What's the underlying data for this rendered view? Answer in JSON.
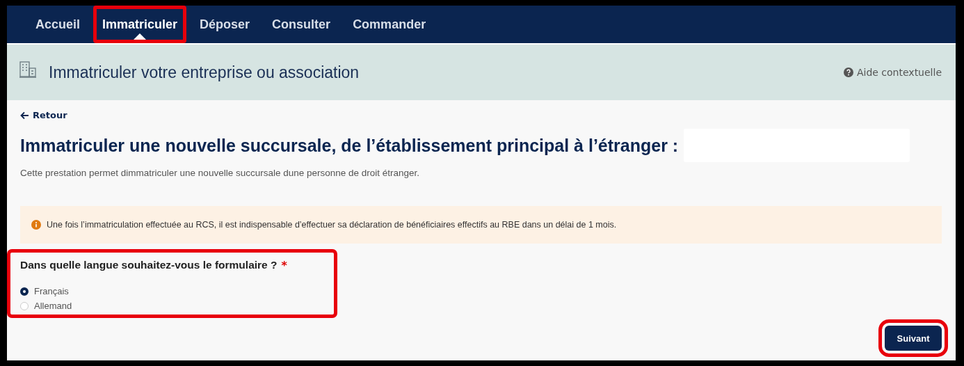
{
  "nav": {
    "tabs": [
      {
        "label": "Accueil",
        "selected": false,
        "highlighted": false
      },
      {
        "label": "Immatriculer",
        "selected": true,
        "highlighted": true
      },
      {
        "label": "Déposer",
        "selected": false,
        "highlighted": false
      },
      {
        "label": "Consulter",
        "selected": false,
        "highlighted": false
      },
      {
        "label": "Commander",
        "selected": false,
        "highlighted": false
      }
    ]
  },
  "header": {
    "title": "Immatriculer votre entreprise ou association",
    "help": "Aide contextuelle"
  },
  "back_link": "Retour",
  "page_title": "Immatriculer une nouvelle succursale, de l’établissement principal à l’étranger :",
  "description": "Cette prestation permet dimmatriculer une nouvelle succursale dune personne de droit étranger.",
  "alert": "Une fois l’immatriculation effectuée au RCS, il est indispensable d’effectuer sa déclaration de bénéficiaires effectifs au RBE dans un délai de 1 mois.",
  "question": {
    "label": "Dans quelle langue souhaitez-vous le formulaire ?",
    "required_mark": "*",
    "highlighted": true,
    "options": [
      {
        "label": "Français",
        "selected": true
      },
      {
        "label": "Allemand",
        "selected": false
      }
    ]
  },
  "next_button": {
    "label": "Suivant",
    "highlighted": true
  }
}
